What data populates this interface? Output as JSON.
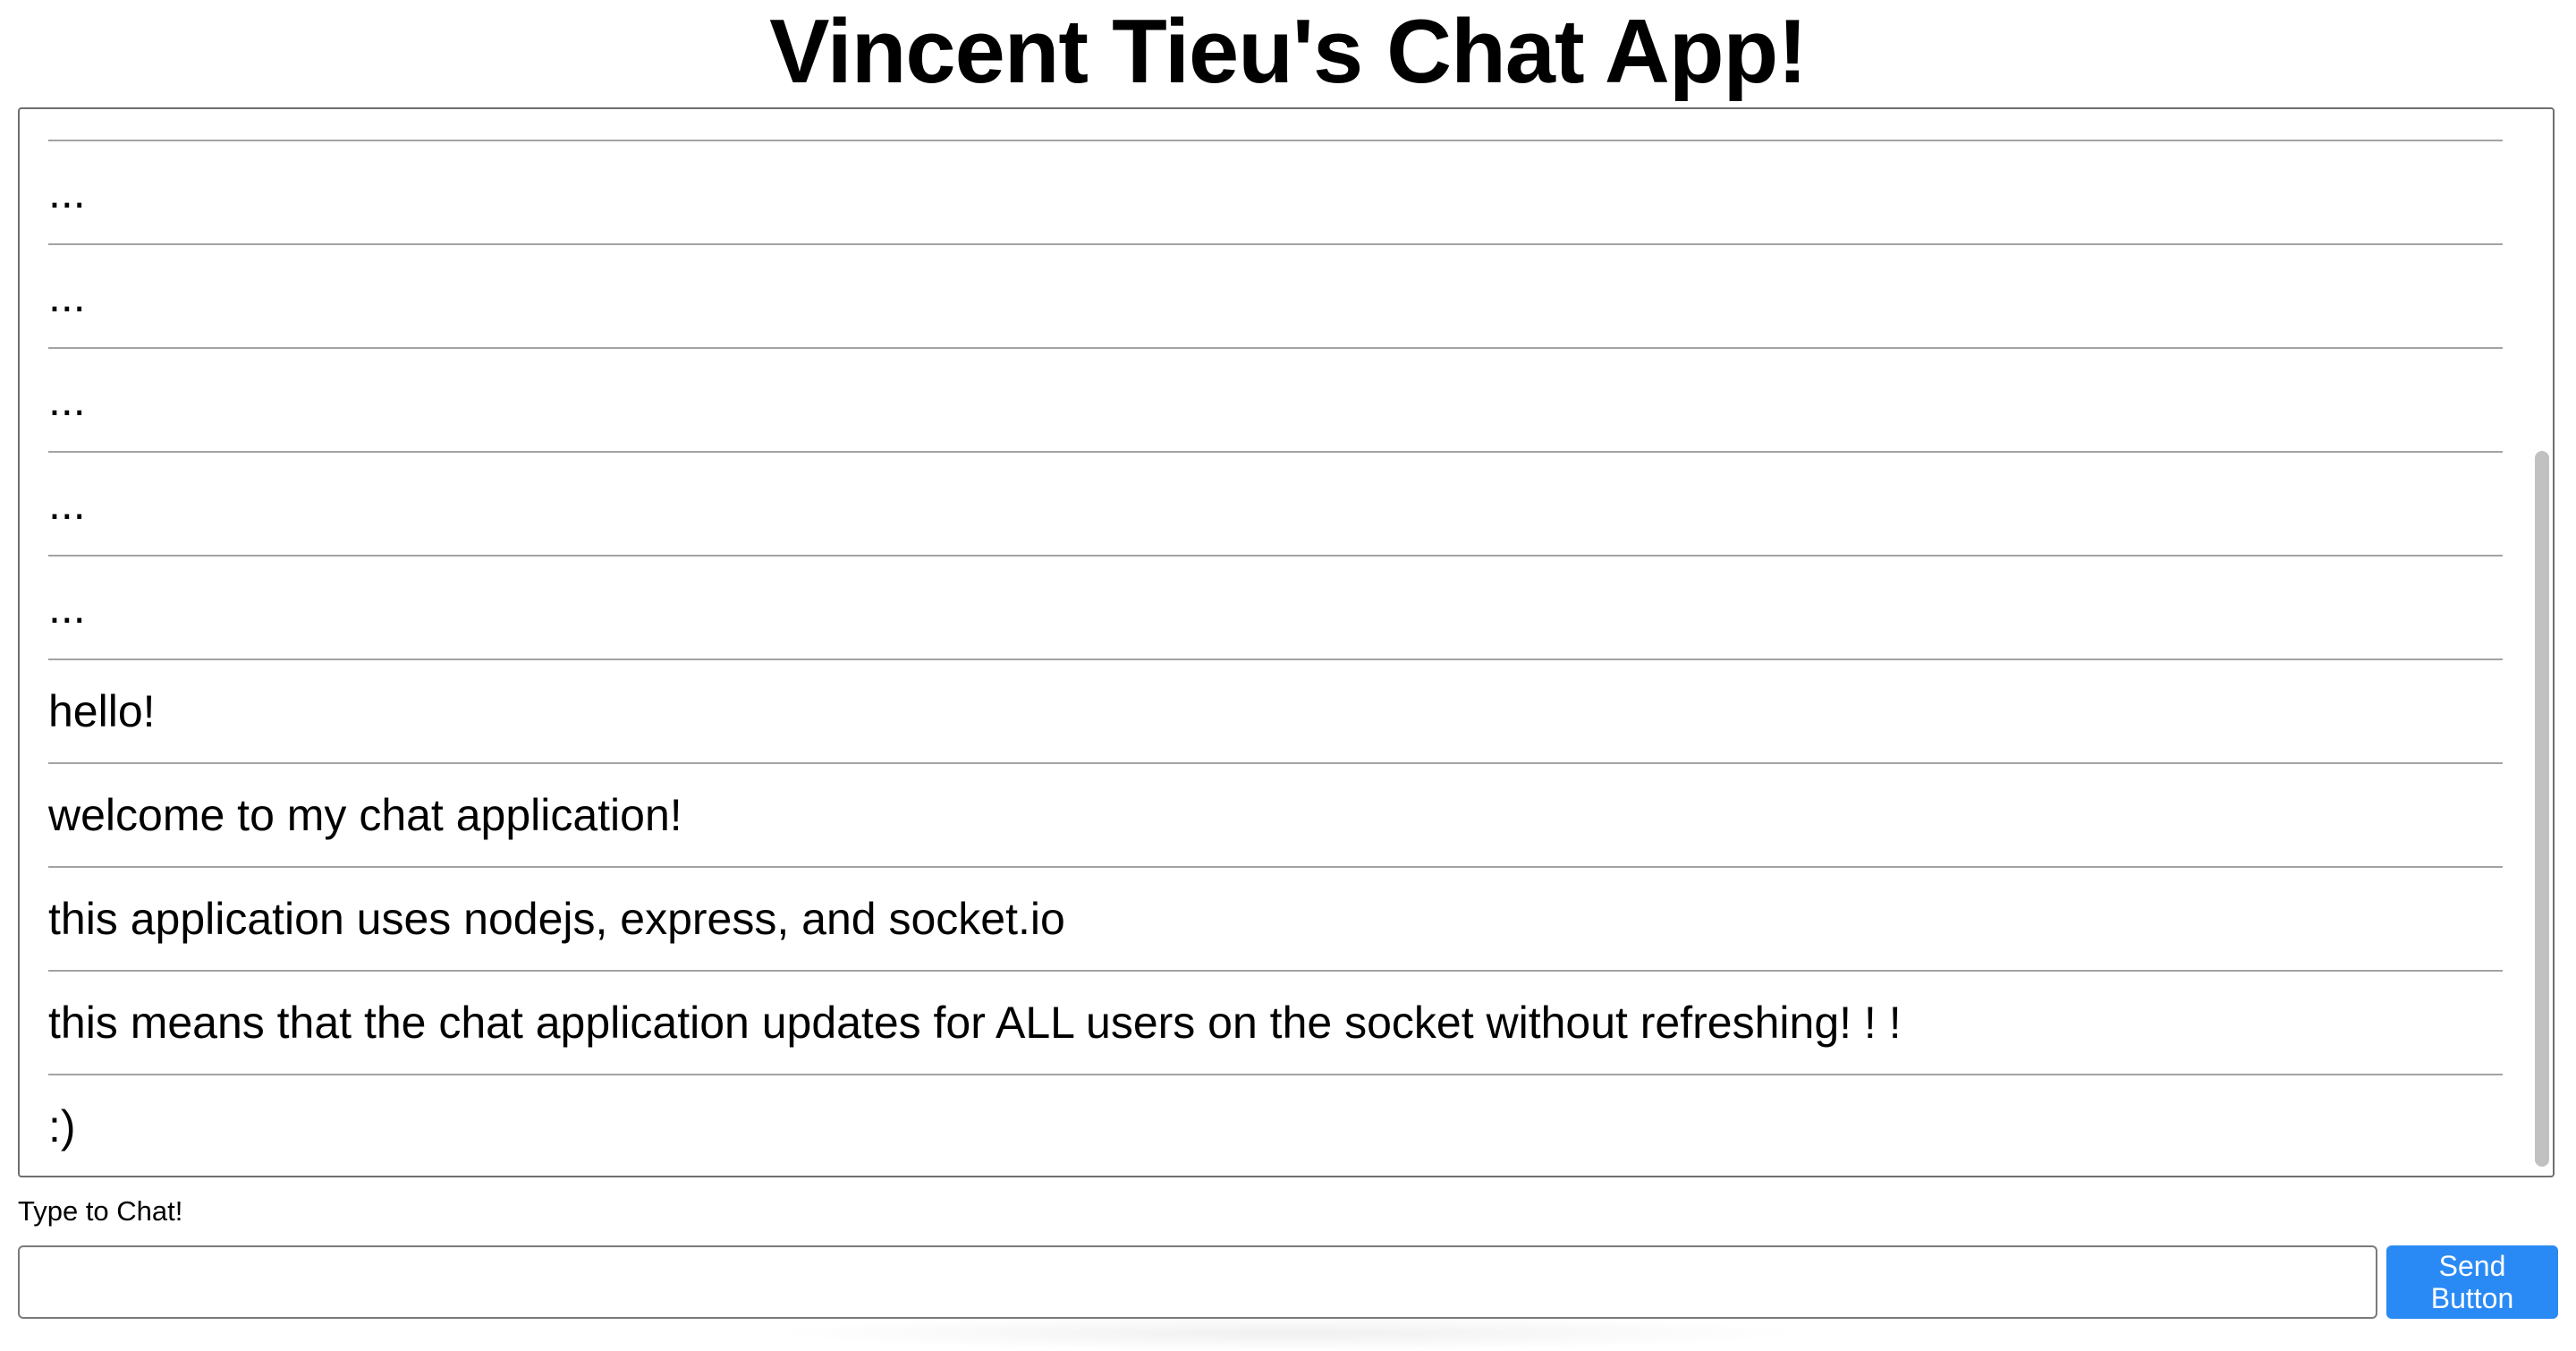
{
  "page": {
    "title": "Vincent Tieu's Chat App!"
  },
  "chat": {
    "messages": [
      "...",
      "...",
      "...",
      "...",
      "...",
      "hello!",
      "welcome to my chat application!",
      "this application uses nodejs, express, and socket.io",
      "this means that the chat application updates for ALL users on the socket without refreshing! ! !",
      ":)"
    ]
  },
  "composer": {
    "label": "Type to Chat!",
    "input_value": "",
    "placeholder": "",
    "send_label": "Send Button",
    "accent_color": "#2a8af5"
  }
}
